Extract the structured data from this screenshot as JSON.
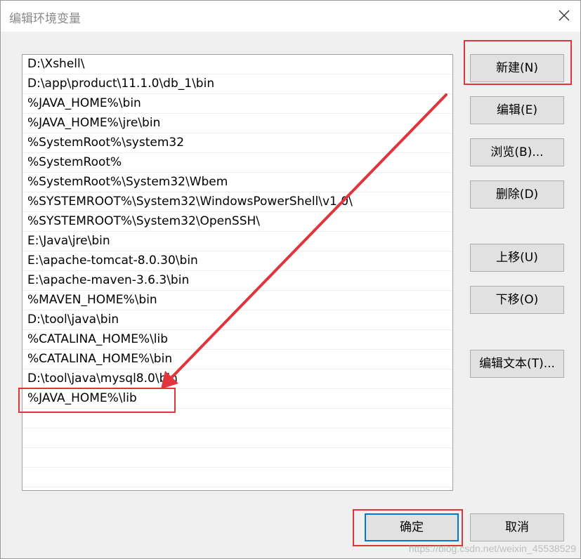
{
  "window": {
    "title": "编辑环境变量",
    "close_icon": "close-icon"
  },
  "path_entries": [
    "D:\\Xshell\\",
    "D:\\app\\product\\11.1.0\\db_1\\bin",
    "%JAVA_HOME%\\bin",
    "%JAVA_HOME%\\jre\\bin",
    "%SystemRoot%\\system32",
    "%SystemRoot%",
    "%SystemRoot%\\System32\\Wbem",
    "%SYSTEMROOT%\\System32\\WindowsPowerShell\\v1.0\\",
    "%SYSTEMROOT%\\System32\\OpenSSH\\",
    "E:\\Java\\jre\\bin",
    "E:\\apache-tomcat-8.0.30\\bin",
    "E:\\apache-maven-3.6.3\\bin",
    "%MAVEN_HOME%\\bin",
    "D:\\tool\\java\\bin",
    "%CATALINA_HOME%\\lib",
    "%CATALINA_HOME%\\bin",
    "D:\\tool\\java\\mysql8.0\\bin",
    "%JAVA_HOME%\\lib"
  ],
  "side_buttons": {
    "new": "新建(N)",
    "edit": "编辑(E)",
    "browse": "浏览(B)...",
    "delete": "删除(D)",
    "move_up": "上移(U)",
    "move_down": "下移(O)",
    "edit_text": "编辑文本(T)..."
  },
  "footer_buttons": {
    "ok": "确定",
    "cancel": "取消"
  },
  "watermark": "https://blog.csdn.net/weixin_45538529",
  "annotation": {
    "color": "#e0353d"
  }
}
